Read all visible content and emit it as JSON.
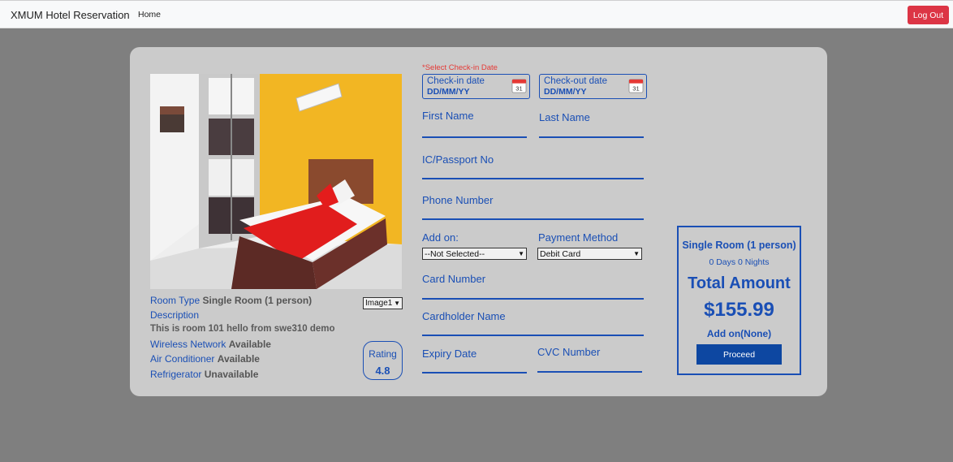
{
  "navbar": {
    "brand": "XMUM Hotel Reservation",
    "home": "Home",
    "logout": "Log Out"
  },
  "room": {
    "type_label": "Room Type",
    "type_value": "Single Room (1 person)",
    "description_label": "Description",
    "description_text": "This is room 101 hello from swe310 demo",
    "wireless_label": "Wireless Network",
    "wireless_value": "Available",
    "ac_label": "Air Conditioner",
    "ac_value": "Available",
    "fridge_label": "Refrigerator",
    "fridge_value": "Unavailable",
    "image_select": "Image1",
    "rating_label": "Rating",
    "rating_value": "4.8"
  },
  "form": {
    "required_note": "*Select Check-in Date",
    "checkin_label": "Check-in date",
    "checkin_value": "DD/MM/YY",
    "checkout_label": "Check-out date",
    "checkout_value": "DD/MM/YY",
    "calendar_day": "31",
    "first_name": "First Name",
    "last_name": "Last Name",
    "ic_passport": "IC/Passport No",
    "phone": "Phone Number",
    "addon_label": "Add on:",
    "addon_value": "--Not Selected--",
    "payment_label": "Payment Method",
    "payment_value": "Debit Card",
    "card_number": "Card Number",
    "cardholder": "Cardholder Name",
    "expiry": "Expiry Date",
    "cvc": "CVC Number"
  },
  "summary": {
    "room": "Single Room (1 person)",
    "days": "0 Days 0 Nights",
    "total_label": "Total Amount",
    "price": "$155.99",
    "addon": "Add on(None)",
    "proceed": "Proceed"
  },
  "colors": {
    "accent": "#1a4fb5",
    "danger": "#dc3545",
    "button": "#0d47a1",
    "card": "#cbcbcb",
    "background": "#7f7f7f"
  }
}
